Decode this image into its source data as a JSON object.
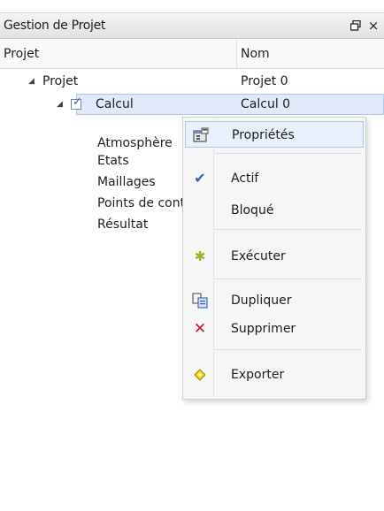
{
  "window": {
    "title": "Gestion de Projet",
    "float_glyph": "ท",
    "close_glyph": "×"
  },
  "columns": [
    "Projet",
    "Nom"
  ],
  "tree": {
    "rows": [
      {
        "label": "Projet",
        "value": "Projet 0",
        "expander": "◢"
      },
      {
        "label": "Calcul",
        "value": "Calcul 0",
        "expander": "◢",
        "checked": true
      },
      {
        "label": "Atmosphère",
        "value": ""
      },
      {
        "label": "Etats",
        "value": ""
      },
      {
        "label": "Maillages",
        "value": ""
      },
      {
        "label": "Points de contrôle",
        "value": ""
      },
      {
        "label": "Résultat",
        "value": ""
      }
    ]
  },
  "context_menu": {
    "items": [
      {
        "label": "Propriétés",
        "icon": "properties-icon"
      },
      {
        "label": "Actif",
        "icon": "checkmark-icon",
        "glyph": "✔"
      },
      {
        "label": "Bloqué",
        "icon": ""
      },
      {
        "label": "Exécuter",
        "icon": "execute-icon",
        "glyph": "✱"
      },
      {
        "label": "Dupliquer",
        "icon": "duplicate-icon"
      },
      {
        "label": "Supprimer",
        "icon": "delete-icon",
        "glyph": "✕"
      },
      {
        "label": "Exporter",
        "icon": "export-icon",
        "glyph": "⬌"
      }
    ]
  },
  "colors": {
    "selection": "#dfe9fa",
    "selection_border": "#aec4ea",
    "check_blue": "#3a5fb0",
    "delete_red": "#c8141e",
    "execute_green": "#9bb320",
    "export_yellow": "#e6c700"
  }
}
